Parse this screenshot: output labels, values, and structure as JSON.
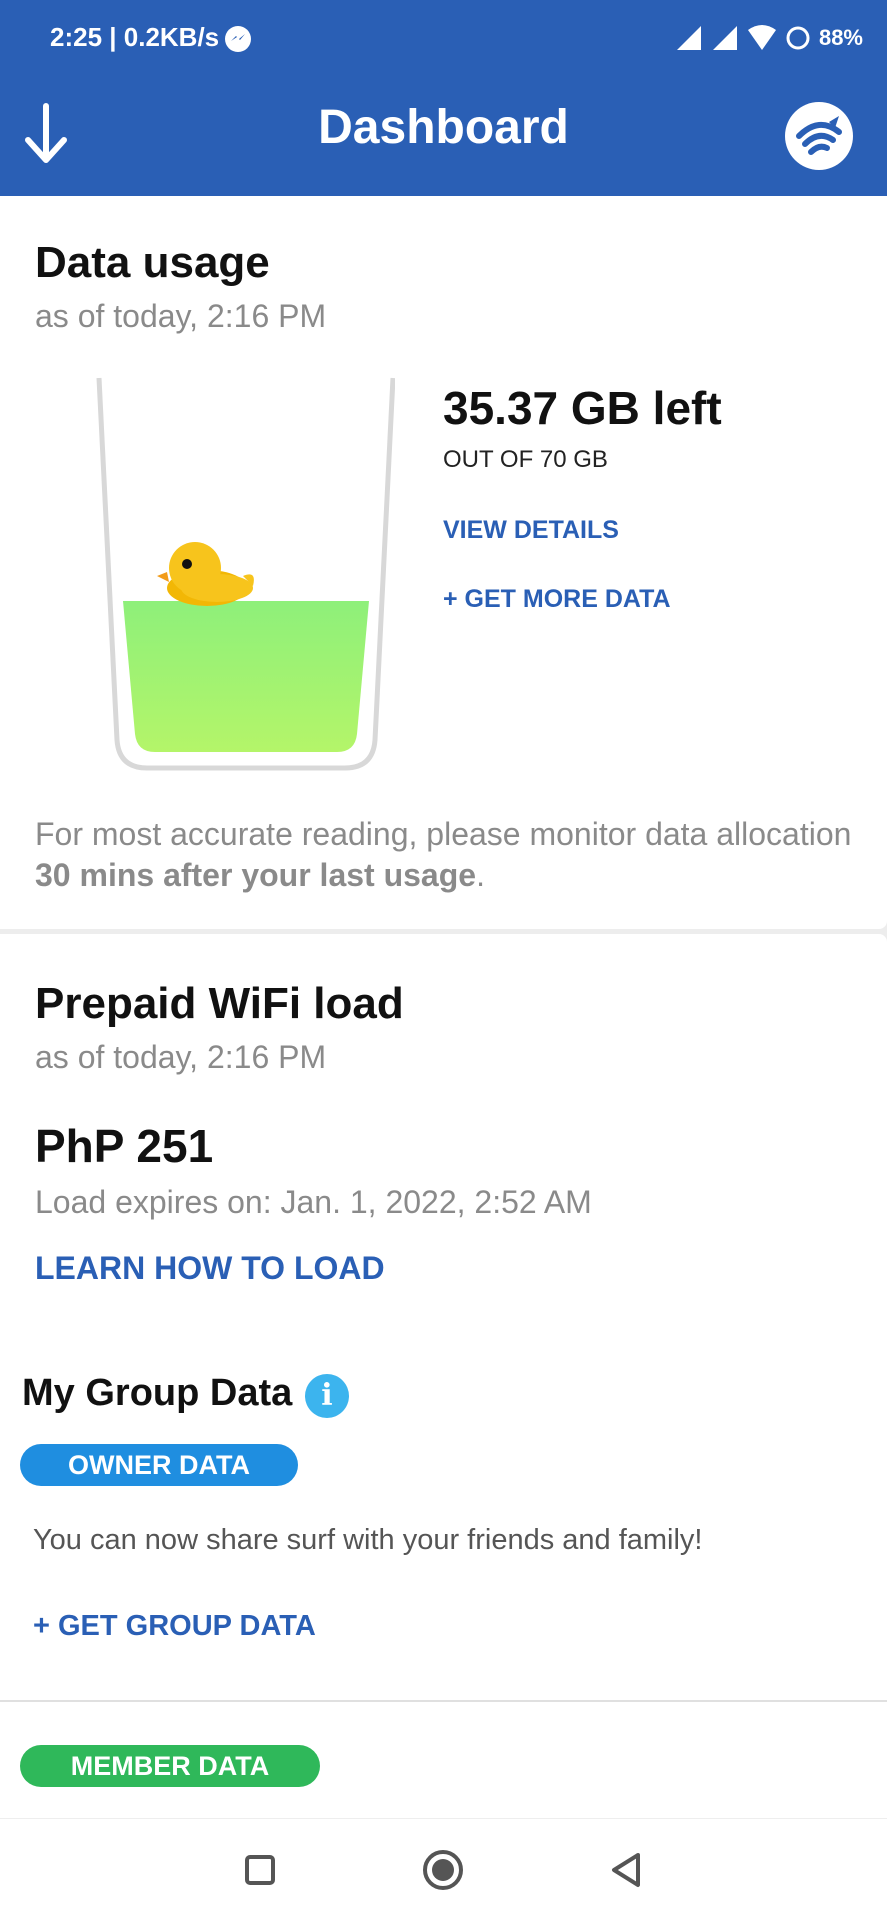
{
  "status_bar": {
    "time_speed": "2:25 | 0.2KB/s",
    "battery": "88%"
  },
  "app_bar": {
    "title": "Dashboard",
    "left_icon": "download-arrow-icon",
    "right_icon": "wifi-logo-icon"
  },
  "data_usage": {
    "title": "Data usage",
    "as_of": "as of today, 2:16 PM",
    "amount_left": "35.37 GB left",
    "out_of": "OUT OF 70 GB",
    "view_details": "VIEW DETAILS",
    "get_more": "+ GET MORE DATA",
    "fill_fraction": 0.505,
    "note_prefix": "For most accurate reading, please monitor data allocation ",
    "note_bold": "30 mins after your last usage",
    "note_suffix": "."
  },
  "prepaid": {
    "title": "Prepaid WiFi load",
    "as_of": "as of today, 2:16 PM",
    "amount": "PhP 251",
    "expiry": "Load expires on: Jan. 1, 2022, 2:52 AM",
    "learn": "LEARN HOW TO LOAD"
  },
  "group_data": {
    "title": "My Group Data",
    "info_glyph": "i",
    "owner_pill": "OWNER DATA",
    "share_text": "You can now share surf with your friends and family!",
    "get_group": "+ GET GROUP DATA",
    "member_pill": "MEMBER DATA"
  },
  "colors": {
    "brand_blue": "#2a5fb5",
    "owner_blue": "#1f8ee0",
    "member_green": "#2fb85a",
    "water_green": "#8ef07a"
  }
}
